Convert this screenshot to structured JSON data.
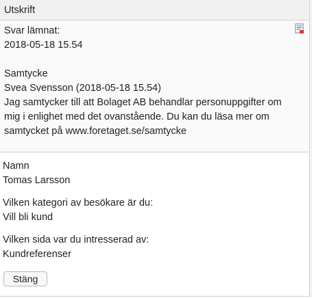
{
  "dialog": {
    "title": "Utskrift",
    "summary": {
      "submitted_label": "Svar lämnat:",
      "submitted_value": "2018-05-18 15.54",
      "consent_heading": "Samtycke",
      "consent_by": "Svea Svensson (2018-05-18 15.54)",
      "consent_text": "Jag samtycker till att Bolaget AB behandlar personuppgifter om mig i enlighet med det ovanstående. Du kan du läsa mer om samtycket på www.foretaget.se/samtycke",
      "print_icon": "pdf-print-icon"
    },
    "fields": [
      {
        "label": "Namn",
        "value": "Tomas Larsson"
      },
      {
        "label": "Vilken kategori av besökare är du:",
        "value": "Vill bli kund"
      },
      {
        "label": "Vilken sida var du intresserad av:",
        "value": "Kundreferenser"
      }
    ],
    "close_label": "Stäng"
  }
}
